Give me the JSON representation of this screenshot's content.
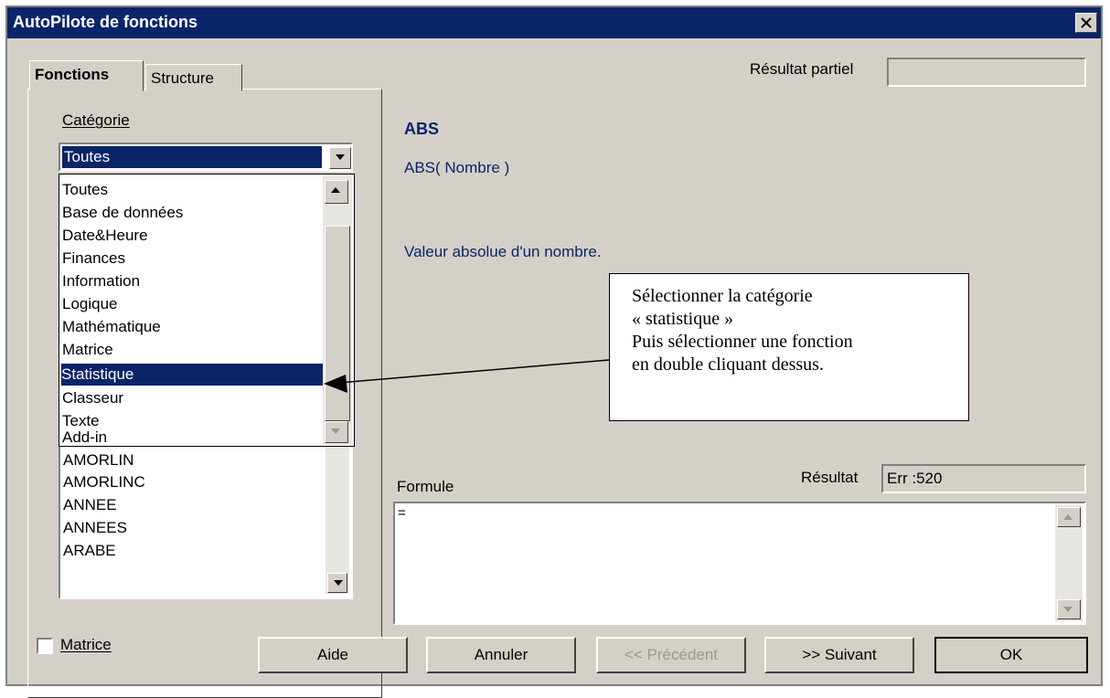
{
  "window": {
    "title": "AutoPilote de fonctions",
    "close_label": "×"
  },
  "tabs": [
    {
      "label": "Fonctions"
    },
    {
      "label": "Structure"
    }
  ],
  "partial_result": {
    "label": "Résultat partiel",
    "value": ""
  },
  "category": {
    "label": "Catégorie",
    "selected": "Toutes",
    "options": [
      "Toutes",
      "Base de données",
      "Date&Heure",
      "Finances",
      "Information",
      "Logique",
      "Mathématique",
      "Matrice",
      "Statistique",
      "Classeur",
      "Texte",
      "Add-in"
    ],
    "highlighted": "Statistique"
  },
  "functions": {
    "items": [
      "AMORLIN",
      "AMORLINC",
      "ANNEE",
      "ANNEES",
      "ARABE"
    ]
  },
  "function_info": {
    "name": "ABS",
    "signature": "ABS( Nombre )",
    "description": "Valeur absolue d'un nombre."
  },
  "callout": {
    "lines": [
      "Sélectionner la catégorie",
      "« statistique »",
      "Puis sélectionner une fonction",
      "en double cliquant dessus."
    ]
  },
  "result": {
    "label": "Résultat",
    "value": "Err :520"
  },
  "formula": {
    "label": "Formule",
    "value": "="
  },
  "matrix_checkbox": {
    "label": "Matrice",
    "checked": false
  },
  "buttons": {
    "help": "Aide",
    "cancel": "Annuler",
    "previous": "<< Précédent",
    "next": ">> Suivant",
    "ok": "OK"
  },
  "colors": {
    "title_bar": "#0a246a",
    "selection": "#0a246a",
    "info_text": "#0a246a",
    "dialog_bg": "#d4d0c8"
  }
}
